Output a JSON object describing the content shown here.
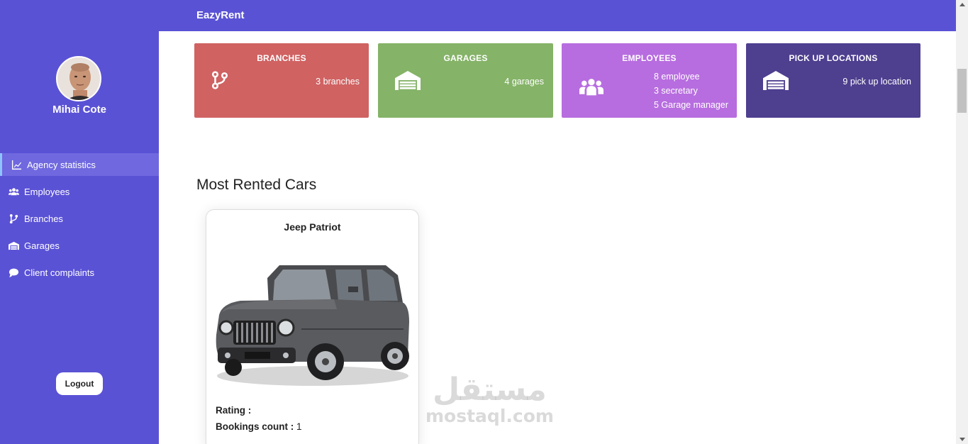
{
  "app": {
    "brand": "EazyRent"
  },
  "user": {
    "name": "Mihai Cote"
  },
  "sidebar": {
    "items": [
      {
        "label": "Agency statistics",
        "icon": "chart-line-icon",
        "active": true
      },
      {
        "label": "Employees",
        "icon": "users-icon"
      },
      {
        "label": "Branches",
        "icon": "code-branch-icon"
      },
      {
        "label": "Garages",
        "icon": "warehouse-icon"
      },
      {
        "label": "Client complaints",
        "icon": "comment-icon"
      }
    ],
    "logout_label": "Logout"
  },
  "cards": {
    "branches": {
      "title": "BRANCHES",
      "value": "3 branches",
      "color": "#d06262",
      "icon": "code-branch-icon"
    },
    "garages": {
      "title": "GARAGES",
      "value": "4 garages",
      "color": "#85b368",
      "icon": "warehouse-icon"
    },
    "employees": {
      "title": "EMPLOYEES",
      "lines": [
        "8 employee",
        "3 secretary",
        "5 Garage manager"
      ],
      "color": "#b76ddf",
      "icon": "users-icon"
    },
    "pickup": {
      "title": "PICK UP LOCATIONS",
      "value": "9 pick up location",
      "color": "#4e3f8f",
      "icon": "warehouse-icon"
    }
  },
  "most_rented": {
    "title": "Most Rented Cars",
    "cars": [
      {
        "name": "Jeep Patriot",
        "rating_label": "Rating :",
        "bookings_label": "Bookings count :",
        "bookings_value": "1"
      }
    ]
  },
  "watermark": {
    "arabic": "مستقل",
    "latin": "mostaql.com"
  },
  "colors": {
    "primary": "#5a52d5",
    "active_item": "#6f68df"
  }
}
